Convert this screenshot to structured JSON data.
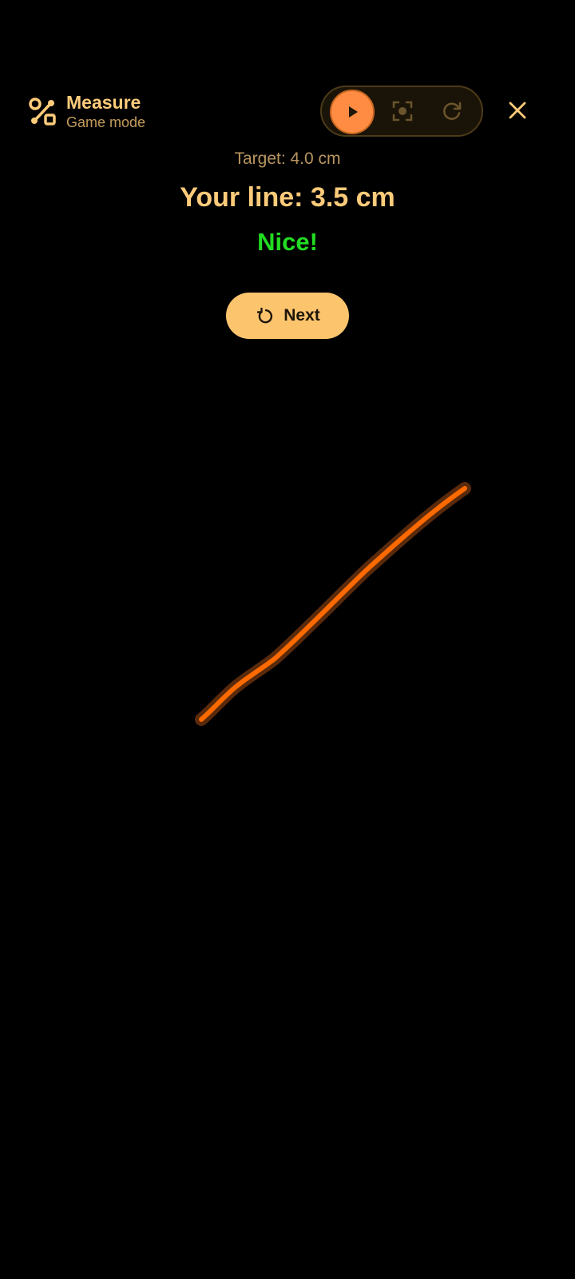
{
  "header": {
    "title": "Measure",
    "subtitle": "Game mode",
    "app_icon": "measure-shapes-icon",
    "controls": {
      "play_icon": "play-icon",
      "focus_icon": "focus-icon",
      "refresh_icon": "refresh-icon"
    },
    "close_icon": "close-icon"
  },
  "game": {
    "target": "Target: 4.0 cm",
    "result": "Your line: 3.5 cm",
    "feedback": "Nice!",
    "next_label": "Next",
    "next_icon": "restart-icon"
  },
  "colors": {
    "accent": "#FDCB7A",
    "button": "#FDC46E",
    "play": "#FF8C42",
    "success": "#22DD22",
    "line": "#FF6A00",
    "background": "#000000"
  }
}
